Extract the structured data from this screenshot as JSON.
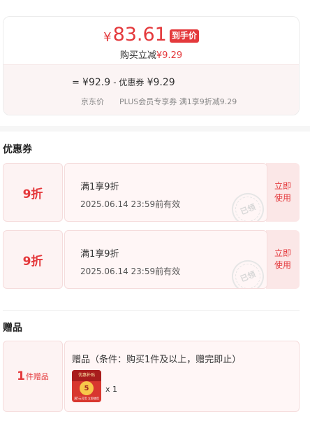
{
  "price": {
    "symbol": "¥",
    "amount": "83.61",
    "tag": "到手价",
    "save_prefix": "购买立减",
    "save_amount": "¥9.29",
    "formula_eq": "=",
    "formula_original": "¥92.9",
    "formula_minus": "- 优惠券",
    "formula_coupon": "¥9.29",
    "label_original": "京东价",
    "label_coupon": "PLUS会员专享券 满1享9折减9.29"
  },
  "coupons": {
    "title": "优惠券",
    "items": [
      {
        "discount": "9折",
        "desc": "满1享9折",
        "valid": "2025.06.14 23:59前有效",
        "action": "立即使用",
        "stamp": "已领"
      },
      {
        "discount": "9折",
        "desc": "满1享9折",
        "valid": "2025.06.14 23:59前有效",
        "action": "立即使用",
        "stamp": "已领"
      }
    ]
  },
  "gift": {
    "title": "赠品",
    "count": "1",
    "count_label": "件赠品",
    "desc": "赠品（条件：购买1件及以上，赠完即止）",
    "thumb_label": "优惠补贴",
    "thumb_coin": "5",
    "thumb_text": "满5元可用 立即使用",
    "quantity": "x 1"
  }
}
